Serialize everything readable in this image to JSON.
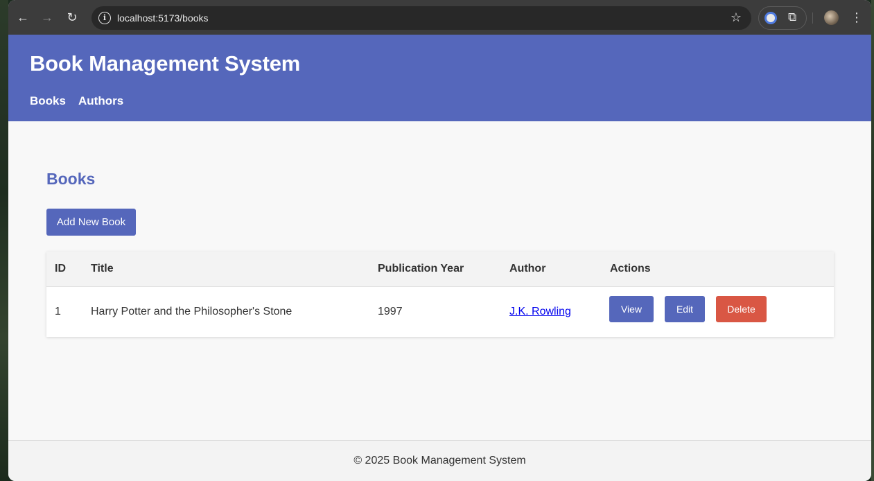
{
  "browser": {
    "url": "localhost:5173/books",
    "back_icon": "←",
    "forward_icon": "→",
    "reload_icon": "↻",
    "info_icon": "i",
    "star_icon": "☆",
    "extensions_icon": "⧉",
    "menu_icon": "⋮"
  },
  "header": {
    "title": "Book Management System",
    "nav": [
      "Books",
      "Authors"
    ]
  },
  "main": {
    "title": "Books",
    "add_button": "Add New Book",
    "table": {
      "columns": [
        "ID",
        "Title",
        "Publication Year",
        "Author",
        "Actions"
      ],
      "rows": [
        {
          "id": "1",
          "title": "Harry Potter and the Philosopher's Stone",
          "year": "1997",
          "author": "J.K. Rowling",
          "actions": [
            "View",
            "Edit",
            "Delete"
          ]
        }
      ]
    }
  },
  "footer": {
    "text": "© 2025 Book Management System"
  },
  "colors": {
    "brand": "#5567bb",
    "danger": "#d95744"
  }
}
